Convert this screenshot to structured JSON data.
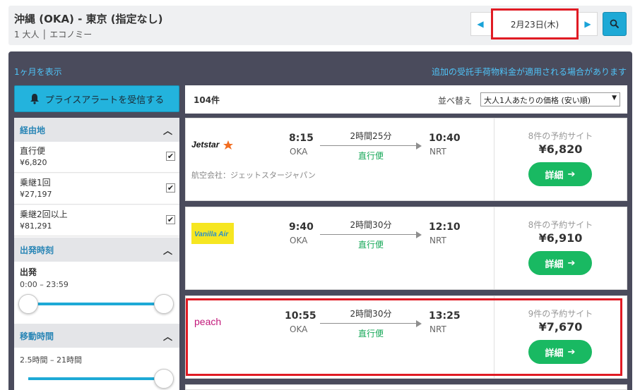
{
  "header": {
    "route_title": "沖縄 (OKA) - 東京 (指定なし)",
    "route_sub": "1 大人 │ エコノミー",
    "date": "2月23日(木)",
    "prev_icon": "chevron-left-icon",
    "next_icon": "chevron-right-icon",
    "search_icon": "search-icon"
  },
  "panel": {
    "month_link": "1ヶ月を表示",
    "baggage_note": "追加の受託手荷物料金が適用される場合があります"
  },
  "sidebar": {
    "price_alert_label": "プライスアラートを受信する",
    "stops_heading": "経由地",
    "stops": [
      {
        "label": "直行便",
        "price": "¥6,820",
        "checked": true
      },
      {
        "label": "乗継1回",
        "price": "¥27,197",
        "checked": true
      },
      {
        "label": "乗継2回以上",
        "price": "¥81,291",
        "checked": true
      }
    ],
    "departure_heading": "出発時刻",
    "departure_label": "出発",
    "departure_range": "0:00 – 23:59",
    "duration_heading": "移動時間",
    "duration_range": "2.5時間 – 21時間",
    "checkmark": "✔"
  },
  "results": {
    "count": "104件",
    "sort_label": "並べ替え",
    "sort_value": "大人1人あたりの価格 (安い順)",
    "detail_label": "詳細",
    "flights": [
      {
        "airline": "Jetstar",
        "operated_by": "航空会社：ジェットスタージャパン",
        "dep_time": "8:15",
        "dep_code": "OKA",
        "duration": "2時間25分",
        "stops": "直行便",
        "arr_time": "10:40",
        "arr_code": "NRT",
        "sites": "8件の予約サイト",
        "price": "¥6,820"
      },
      {
        "airline": "Vanilla Air",
        "operated_by": "",
        "dep_time": "9:40",
        "dep_code": "OKA",
        "duration": "2時間30分",
        "stops": "直行便",
        "arr_time": "12:10",
        "arr_code": "NRT",
        "sites": "8件の予約サイト",
        "price": "¥6,910"
      },
      {
        "airline": "peach",
        "operated_by": "",
        "dep_time": "10:55",
        "dep_code": "OKA",
        "duration": "2時間30分",
        "stops": "直行便",
        "arr_time": "13:25",
        "arr_code": "NRT",
        "sites": "9件の予約サイト",
        "price": "¥7,670"
      }
    ]
  },
  "colors": {
    "accent": "#1ea9d6",
    "panel": "#4a4b5c",
    "book_button": "#19b962",
    "highlight": "#e01b24"
  }
}
